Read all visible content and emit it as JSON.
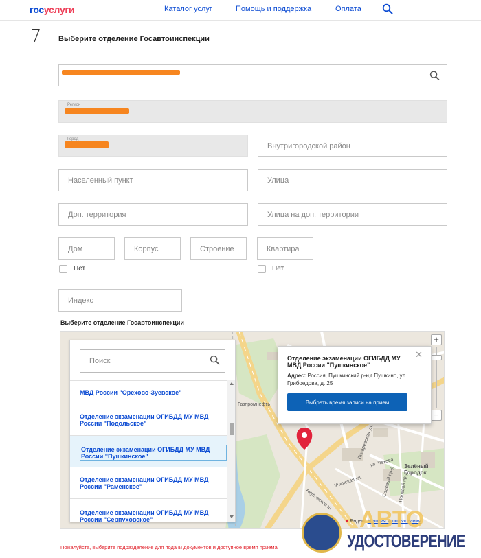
{
  "header": {
    "logo_part1": "гос",
    "logo_part2": "услуги",
    "nav": [
      "Каталог услуг",
      "Помощь и поддержка",
      "Оплата"
    ]
  },
  "step": {
    "number": "7",
    "title": "Выберите отделение Госавтоинспекции"
  },
  "form": {
    "region_label": "Регион",
    "city_label": "Город",
    "district_placeholder": "Внутригородской район",
    "locality_placeholder": "Населенный пункт",
    "street_placeholder": "Улица",
    "extra_territory_placeholder": "Доп. территория",
    "extra_street_placeholder": "Улица на доп. территории",
    "house_placeholder": "Дом",
    "building_placeholder": "Корпус",
    "structure_placeholder": "Строение",
    "apartment_placeholder": "Квартира",
    "no_house_label": "Нет",
    "no_apartment_label": "Нет",
    "index_placeholder": "Индекс"
  },
  "section_title": "Выберите отделение Госавтоинспекции",
  "list": {
    "search_placeholder": "Поиск",
    "items": [
      "МВД России \"Орехово-Зуевское\"",
      "Отделение экзаменации ОГИБДД МУ МВД России \"Подольское\"",
      "Отделение экзаменации ОГИБДД МУ МВД России \"Пушкинское\"",
      "Отделение экзаменации ОГИБДД МУ МВД России \"Раменское\"",
      "Отделение экзаменации ОГИБДД МУ МВД России \"Серпуховское\""
    ],
    "selected_index": 2
  },
  "popup": {
    "title": "Отделение экзаменации ОГИБДД МУ МВД России \"Пушкинское\"",
    "address_label": "Адрес:",
    "address_value": "Россия, Пушкинский р-н,г Пушкино, ул. Грибоедова, д. 25",
    "button_label": "Выбрать время записи на прием"
  },
  "map": {
    "zoom_in": "+",
    "zoom_out": "−",
    "labels": {
      "gazprom": "Газпромнефть",
      "green_town": "Зелёный Городок",
      "akulovskoe": "Акуловское ш.",
      "uchinskaya": "Учинская ул.",
      "chekhova": "ул. Чехова",
      "sadovy": "Садовый пр-д",
      "polevoy": "Полевой пр-д",
      "pisarevskaya": "Писаревская ул.",
      "yandex": "Яндекс",
      "terms": "Условия использования"
    }
  },
  "error_text": "Пожалуйста, выберите подразделение для подачи документов и доступное время приема",
  "watermark": {
    "avto": "АВТО",
    "text": "УДОСТОВЕРЕНИЕ"
  },
  "colors": {
    "link": "#0d4cd3",
    "logo_red": "#ee3f58",
    "button": "#0d62b6",
    "error": "#e0202a",
    "redaction": "#f77f14"
  }
}
